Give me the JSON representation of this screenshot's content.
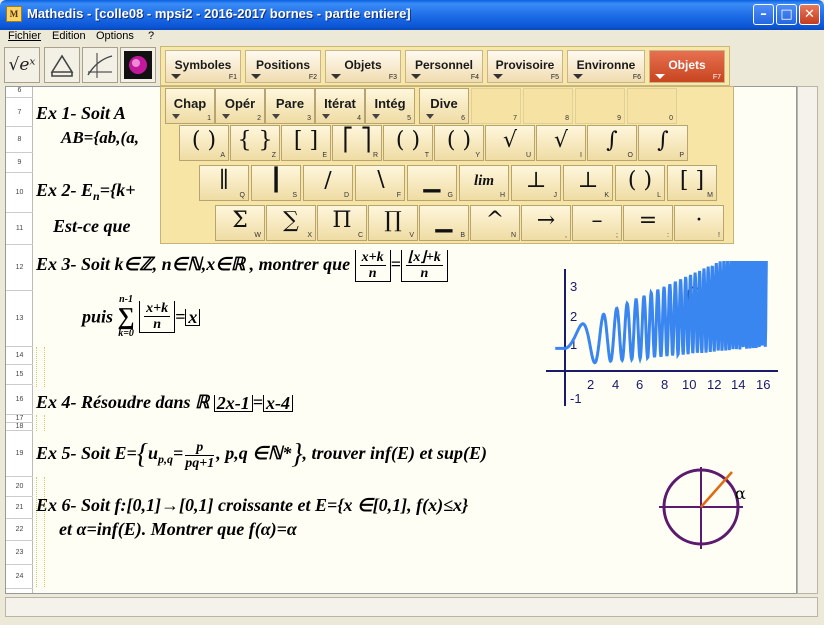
{
  "window": {
    "title": "Mathedis  -  [colle08 - mpsi2 - 2016-2017 bornes - partie entiere]",
    "min_btn": "–",
    "max_btn": "□",
    "close_btn": "✕"
  },
  "menu": {
    "items": [
      "Fichier",
      "Edition",
      "Options",
      "?"
    ]
  },
  "toolbar": {
    "icons": [
      "sqrt-exp-icon",
      "prism-icon",
      "graph-icon",
      "image-icon"
    ],
    "sqrt_label": "√eˣ"
  },
  "categories": {
    "tabs": [
      {
        "label": "Symboles",
        "key": "F1"
      },
      {
        "label": "Positions",
        "key": "F2"
      },
      {
        "label": "Objets",
        "key": "F3"
      },
      {
        "label": "Personnel",
        "key": "F4"
      },
      {
        "label": "Provisoire",
        "key": "F5"
      },
      {
        "label": "Environne",
        "key": "F6"
      },
      {
        "label": "Objets",
        "key": "F7"
      }
    ]
  },
  "palette": {
    "row1": [
      {
        "label": "Chap",
        "key": "1"
      },
      {
        "label": "Opér",
        "key": "2"
      },
      {
        "label": "Pare",
        "key": "3"
      },
      {
        "label": "Itérat",
        "key": "4"
      },
      {
        "label": "Intég",
        "key": "5"
      },
      {
        "label": "Dive",
        "key": "6"
      },
      {
        "label": "",
        "key": "7"
      },
      {
        "label": "",
        "key": "8"
      },
      {
        "label": "",
        "key": "9"
      },
      {
        "label": "",
        "key": "0"
      }
    ],
    "row2": [
      {
        "sym": "( )",
        "key": "A"
      },
      {
        "sym": "{ }",
        "key": "Z"
      },
      {
        "sym": "[ ]",
        "key": "E"
      },
      {
        "sym": "⎡ ⎤",
        "key": "R"
      },
      {
        "sym": "( )",
        "key": "T"
      },
      {
        "sym": "( )",
        "key": "Y"
      },
      {
        "sym": "√",
        "key": "U"
      },
      {
        "sym": "√",
        "key": "I"
      },
      {
        "sym": "∫",
        "key": "O"
      },
      {
        "sym": "∫",
        "key": "P"
      }
    ],
    "row3": [
      {
        "sym": "∥",
        "key": "Q"
      },
      {
        "sym": "┃",
        "key": "S"
      },
      {
        "sym": "∕",
        "key": "D"
      },
      {
        "sym": "∖",
        "key": "F"
      },
      {
        "sym": "▁",
        "key": "G"
      },
      {
        "sym": "lim",
        "key": "H"
      },
      {
        "sym": "⊥",
        "key": "J"
      },
      {
        "sym": "⊥",
        "key": "K"
      },
      {
        "sym": "( )",
        "key": "L"
      },
      {
        "sym": "[ ]",
        "key": "M"
      }
    ],
    "row4": [
      {
        "sym": "Σ",
        "key": "W"
      },
      {
        "sym": "∑",
        "key": "X"
      },
      {
        "sym": "Π",
        "key": "C"
      },
      {
        "sym": "∏",
        "key": "V"
      },
      {
        "sym": "▁",
        "key": "B"
      },
      {
        "sym": "^",
        "key": "N"
      },
      {
        "sym": "→",
        "key": ","
      },
      {
        "sym": "–",
        "key": ";"
      },
      {
        "sym": "=",
        "key": ":"
      },
      {
        "sym": "·",
        "key": "!"
      }
    ]
  },
  "document": {
    "line_numbers": [
      "6",
      "7",
      "8",
      "9",
      "10",
      "11",
      "12",
      "13",
      "14",
      "15",
      "16",
      "17",
      "18",
      "19",
      "20",
      "21",
      "22",
      "23",
      "24"
    ],
    "ex1": {
      "title": "Ex 1-  Soit A",
      "line2": "AB={ab,(a,"
    },
    "ex2": {
      "title": "Ex 2-  E",
      "sub": "n",
      "rest": "={k+",
      "line2": "Est-ce que"
    },
    "ex3": {
      "text": "Ex 3- Soit k∈ℤ, n∈ℕ,x∈ℝ , montrer que",
      "num1": "x+k",
      "den1": "n",
      "eq": "=",
      "num2": "⌊x⌋+k",
      "den2": "n",
      "line2_pre": "puis",
      "sum_top": "n-1",
      "sum_bot": "k=0",
      "sum_sym": "∑",
      "num3": "x+k",
      "den3": "n",
      "eq2": "=",
      "floor_x": "x"
    },
    "ex4": {
      "text": "Ex 4- Résoudre dans ℝ",
      "a": "2x-1",
      "eq": "=",
      "b": "x-4"
    },
    "ex5": {
      "text": "Ex 5-  Soit E=",
      "u": "u",
      "u_sub": "p,q",
      "eqfrac": "=",
      "num": "p",
      "den": "pq+1",
      "rest": ", p,q ∈ℕ*",
      "tail": ", trouver inf(E) et sup(E)"
    },
    "ex6": {
      "line1": "Ex 6-  Soit  f:[0,1]→[0,1] croissante et E={x ∈[0,1], f(x)≤x}",
      "line2": "et α=inf(E).  Montrer que f(α)=α"
    }
  },
  "graph": {
    "label": "f(x)",
    "y_ticks": [
      "3",
      "2",
      "1",
      "-1"
    ],
    "x_ticks": [
      "2",
      "4",
      "6",
      "8",
      "10",
      "12",
      "14",
      "16"
    ],
    "curve_color": "#3a86f0",
    "axis_color": "#1a1a6a"
  },
  "circle": {
    "label": "α",
    "circle_color": "#5b1a6e",
    "ray_color": "#e06a10"
  }
}
